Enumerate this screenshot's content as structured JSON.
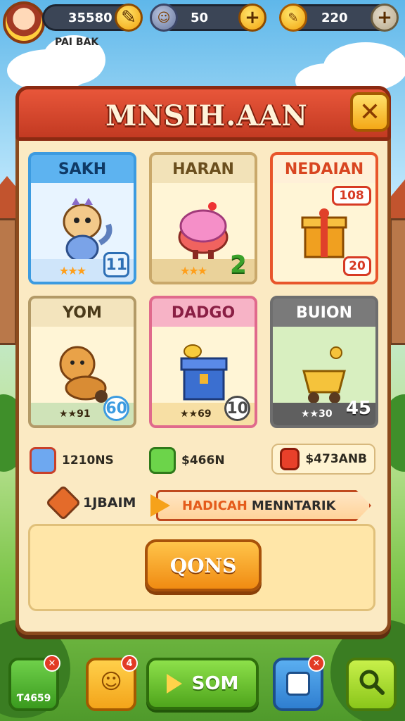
{
  "topbar": {
    "player_name": "PAI BAK",
    "currency_1": "35580",
    "currency_2": "50",
    "currency_3": "220",
    "plus": "+"
  },
  "panel": {
    "title": "MNSIH.AAN",
    "close": "✕"
  },
  "cards": [
    {
      "title": "SAKH",
      "badge": "11",
      "color": "#3c9be0"
    },
    {
      "title": "HARAN",
      "badge": "2",
      "color": "#c9a86a"
    },
    {
      "title": "NEDAIAN",
      "tag_top": "108",
      "tag_bottom": "20",
      "color": "#e8552b"
    },
    {
      "title": "YOM",
      "footer": "★★91",
      "badge": "60",
      "color": "#b39a67"
    },
    {
      "title": "DADGO",
      "footer": "★★69",
      "badge": "10",
      "color": "#e06a8c"
    },
    {
      "title": "BUION",
      "footer": "★★30",
      "badge": "45",
      "color": "#6e6e6e"
    }
  ],
  "resources": [
    {
      "label": "1210NS"
    },
    {
      "label": "$466N"
    },
    {
      "label": "$473ANB"
    }
  ],
  "rank": {
    "label": "1JBAIM"
  },
  "banner": {
    "part1": "HADICAH",
    "part2": "MENNTARIK"
  },
  "main_button": "QONS",
  "bottom_nav": {
    "item1_label": "Ƭ4659",
    "item2_badge": "4",
    "play_label": "SOM",
    "item4_badge": "✕"
  }
}
